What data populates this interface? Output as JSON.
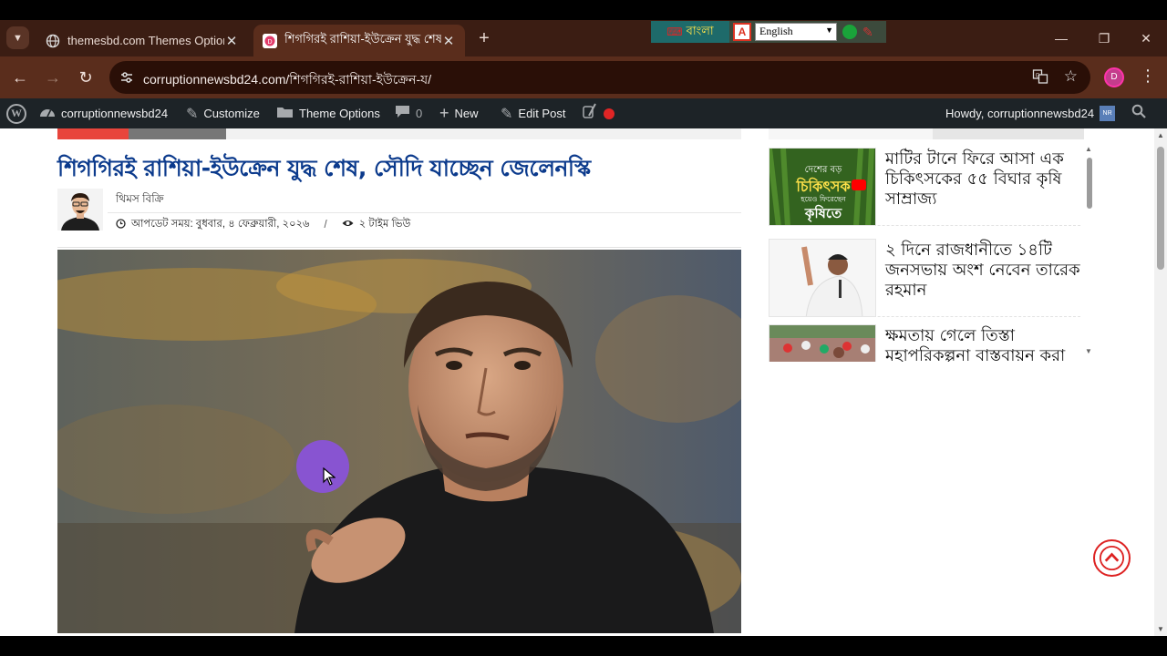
{
  "browser": {
    "tabs": [
      {
        "title": "themesbd.com Themes Options",
        "active": false
      },
      {
        "title": "শিগগিরই রাশিয়া-ইউক্রেন যুদ্ধ শেষ",
        "active": true
      }
    ],
    "new_tab_label": "+",
    "address": "corruptionnewsbd24.com/শিগগিরই-রাশিয়া-ইউক্রেন-য/",
    "language_widget": {
      "bijoy_label": "বাংলা",
      "selected_language": "English"
    }
  },
  "wp_admin_bar": {
    "site_name": "corruptionnewsbd24",
    "customize": "Customize",
    "theme_options": "Theme Options",
    "comments_count": "0",
    "new": "New",
    "edit_post": "Edit Post",
    "howdy": "Howdy, corruptionnewsbd24"
  },
  "article": {
    "headline": "শিগগিরই রাশিয়া-ইউক্রেন যুদ্ধ শেষ, সৌদি যাচ্ছেন জেলেনস্কি",
    "author": "থিমস বিক্রি",
    "updated": "আপডেট সময়: বুধবার, ৪ ফেব্রুয়ারী, ২০২৬",
    "views": "২ টাইম ভিউ"
  },
  "sidebar": {
    "items": [
      {
        "title": "মাটির টানে ফিরে আসা এক চিকিৎসকের ৫৫ বিঘার কৃষি সাম্রাজ্য",
        "thumb_caption_top": "দেশের বড়",
        "thumb_caption_mid": "চিকিৎসক",
        "thumb_caption_small": "হয়েও ফিরেছেন",
        "thumb_caption_bottom": "কৃষিতে"
      },
      {
        "title": "২ দিনে রাজধানীতে ১৪টি জনসভায় অংশ নেবেন তারেক রহমান"
      },
      {
        "title": "ক্ষমতায় গেলে তিস্তা মহাপরিকল্পনা বাস্তবায়ন করা হবে"
      }
    ]
  },
  "colors": {
    "headline": "#0b3a8c",
    "accent_red": "#e8453c",
    "wpbar": "#1d2327",
    "browser_frame": "#3b1d13"
  }
}
